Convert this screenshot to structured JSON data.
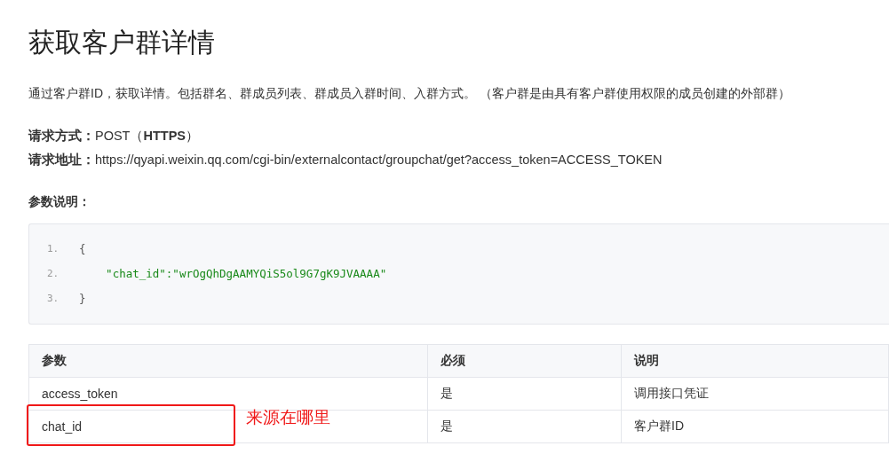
{
  "title": "获取客户群详情",
  "description": "通过客户群ID，获取详情。包括群名、群成员列表、群成员入群时间、入群方式。 （客户群是由具有客户群使用权限的成员创建的外部群）",
  "request": [
    {
      "label": "请求方式：",
      "value": "POST（**HTTPS**）"
    },
    {
      "label": "请求地址：",
      "value": "https://qyapi.weixin.qq.com/cgi-bin/externalcontact/groupchat/get?access_token=ACCESS_TOKEN"
    }
  ],
  "params_heading": "参数说明：",
  "code_lines": [
    {
      "number": "1.",
      "text": "{",
      "kind": "punct"
    },
    {
      "number": "2.",
      "text": "    \"chat_id\":\"wrOgQhDgAAMYQiS5ol9G7gK9JVAAAA\"",
      "kind": "string"
    },
    {
      "number": "3.",
      "text": "}",
      "kind": "punct"
    }
  ],
  "table": {
    "columns": [
      "参数",
      "必须",
      "说明"
    ],
    "rows": [
      {
        "cells": [
          "access_token",
          "是",
          "调用接口凭证"
        ],
        "highlighted": false
      },
      {
        "cells": [
          "chat_id",
          "是",
          "客户群ID"
        ],
        "highlighted": true
      }
    ]
  },
  "annotation": {
    "text": "来源在哪里"
  }
}
